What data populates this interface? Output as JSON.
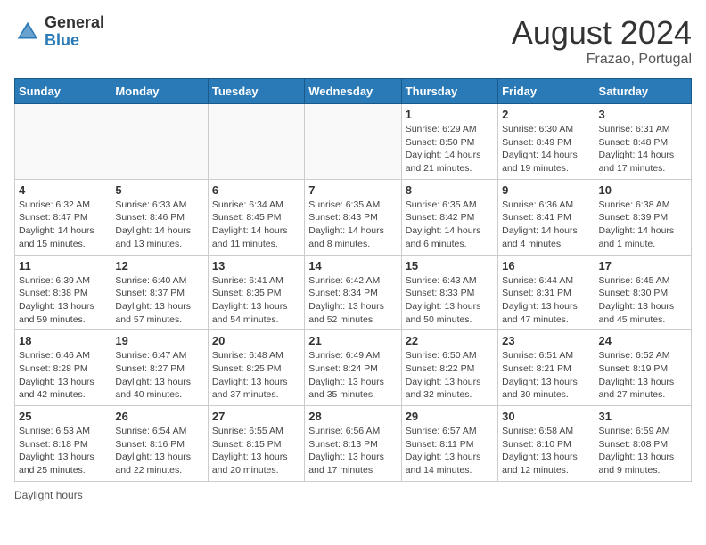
{
  "header": {
    "logo_general": "General",
    "logo_blue": "Blue",
    "month_title": "August 2024",
    "subtitle": "Frazao, Portugal"
  },
  "days_of_week": [
    "Sunday",
    "Monday",
    "Tuesday",
    "Wednesday",
    "Thursday",
    "Friday",
    "Saturday"
  ],
  "footer": {
    "note": "Daylight hours"
  },
  "weeks": [
    [
      {
        "day": "",
        "info": ""
      },
      {
        "day": "",
        "info": ""
      },
      {
        "day": "",
        "info": ""
      },
      {
        "day": "",
        "info": ""
      },
      {
        "day": "1",
        "info": "Sunrise: 6:29 AM\nSunset: 8:50 PM\nDaylight: 14 hours\nand 21 minutes."
      },
      {
        "day": "2",
        "info": "Sunrise: 6:30 AM\nSunset: 8:49 PM\nDaylight: 14 hours\nand 19 minutes."
      },
      {
        "day": "3",
        "info": "Sunrise: 6:31 AM\nSunset: 8:48 PM\nDaylight: 14 hours\nand 17 minutes."
      }
    ],
    [
      {
        "day": "4",
        "info": "Sunrise: 6:32 AM\nSunset: 8:47 PM\nDaylight: 14 hours\nand 15 minutes."
      },
      {
        "day": "5",
        "info": "Sunrise: 6:33 AM\nSunset: 8:46 PM\nDaylight: 14 hours\nand 13 minutes."
      },
      {
        "day": "6",
        "info": "Sunrise: 6:34 AM\nSunset: 8:45 PM\nDaylight: 14 hours\nand 11 minutes."
      },
      {
        "day": "7",
        "info": "Sunrise: 6:35 AM\nSunset: 8:43 PM\nDaylight: 14 hours\nand 8 minutes."
      },
      {
        "day": "8",
        "info": "Sunrise: 6:35 AM\nSunset: 8:42 PM\nDaylight: 14 hours\nand 6 minutes."
      },
      {
        "day": "9",
        "info": "Sunrise: 6:36 AM\nSunset: 8:41 PM\nDaylight: 14 hours\nand 4 minutes."
      },
      {
        "day": "10",
        "info": "Sunrise: 6:38 AM\nSunset: 8:39 PM\nDaylight: 14 hours\nand 1 minute."
      }
    ],
    [
      {
        "day": "11",
        "info": "Sunrise: 6:39 AM\nSunset: 8:38 PM\nDaylight: 13 hours\nand 59 minutes."
      },
      {
        "day": "12",
        "info": "Sunrise: 6:40 AM\nSunset: 8:37 PM\nDaylight: 13 hours\nand 57 minutes."
      },
      {
        "day": "13",
        "info": "Sunrise: 6:41 AM\nSunset: 8:35 PM\nDaylight: 13 hours\nand 54 minutes."
      },
      {
        "day": "14",
        "info": "Sunrise: 6:42 AM\nSunset: 8:34 PM\nDaylight: 13 hours\nand 52 minutes."
      },
      {
        "day": "15",
        "info": "Sunrise: 6:43 AM\nSunset: 8:33 PM\nDaylight: 13 hours\nand 50 minutes."
      },
      {
        "day": "16",
        "info": "Sunrise: 6:44 AM\nSunset: 8:31 PM\nDaylight: 13 hours\nand 47 minutes."
      },
      {
        "day": "17",
        "info": "Sunrise: 6:45 AM\nSunset: 8:30 PM\nDaylight: 13 hours\nand 45 minutes."
      }
    ],
    [
      {
        "day": "18",
        "info": "Sunrise: 6:46 AM\nSunset: 8:28 PM\nDaylight: 13 hours\nand 42 minutes."
      },
      {
        "day": "19",
        "info": "Sunrise: 6:47 AM\nSunset: 8:27 PM\nDaylight: 13 hours\nand 40 minutes."
      },
      {
        "day": "20",
        "info": "Sunrise: 6:48 AM\nSunset: 8:25 PM\nDaylight: 13 hours\nand 37 minutes."
      },
      {
        "day": "21",
        "info": "Sunrise: 6:49 AM\nSunset: 8:24 PM\nDaylight: 13 hours\nand 35 minutes."
      },
      {
        "day": "22",
        "info": "Sunrise: 6:50 AM\nSunset: 8:22 PM\nDaylight: 13 hours\nand 32 minutes."
      },
      {
        "day": "23",
        "info": "Sunrise: 6:51 AM\nSunset: 8:21 PM\nDaylight: 13 hours\nand 30 minutes."
      },
      {
        "day": "24",
        "info": "Sunrise: 6:52 AM\nSunset: 8:19 PM\nDaylight: 13 hours\nand 27 minutes."
      }
    ],
    [
      {
        "day": "25",
        "info": "Sunrise: 6:53 AM\nSunset: 8:18 PM\nDaylight: 13 hours\nand 25 minutes."
      },
      {
        "day": "26",
        "info": "Sunrise: 6:54 AM\nSunset: 8:16 PM\nDaylight: 13 hours\nand 22 minutes."
      },
      {
        "day": "27",
        "info": "Sunrise: 6:55 AM\nSunset: 8:15 PM\nDaylight: 13 hours\nand 20 minutes."
      },
      {
        "day": "28",
        "info": "Sunrise: 6:56 AM\nSunset: 8:13 PM\nDaylight: 13 hours\nand 17 minutes."
      },
      {
        "day": "29",
        "info": "Sunrise: 6:57 AM\nSunset: 8:11 PM\nDaylight: 13 hours\nand 14 minutes."
      },
      {
        "day": "30",
        "info": "Sunrise: 6:58 AM\nSunset: 8:10 PM\nDaylight: 13 hours\nand 12 minutes."
      },
      {
        "day": "31",
        "info": "Sunrise: 6:59 AM\nSunset: 8:08 PM\nDaylight: 13 hours\nand 9 minutes."
      }
    ]
  ]
}
